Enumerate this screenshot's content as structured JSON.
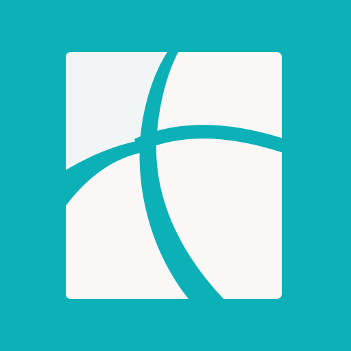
{
  "app_icon": {
    "icon": "abstract-quadrant-logo-icon",
    "colors": {
      "background": "#0cb1b8",
      "panel": "#faf7f7",
      "panel_top_left": "#f2f5f6",
      "curves": "#0cb1b8"
    }
  }
}
